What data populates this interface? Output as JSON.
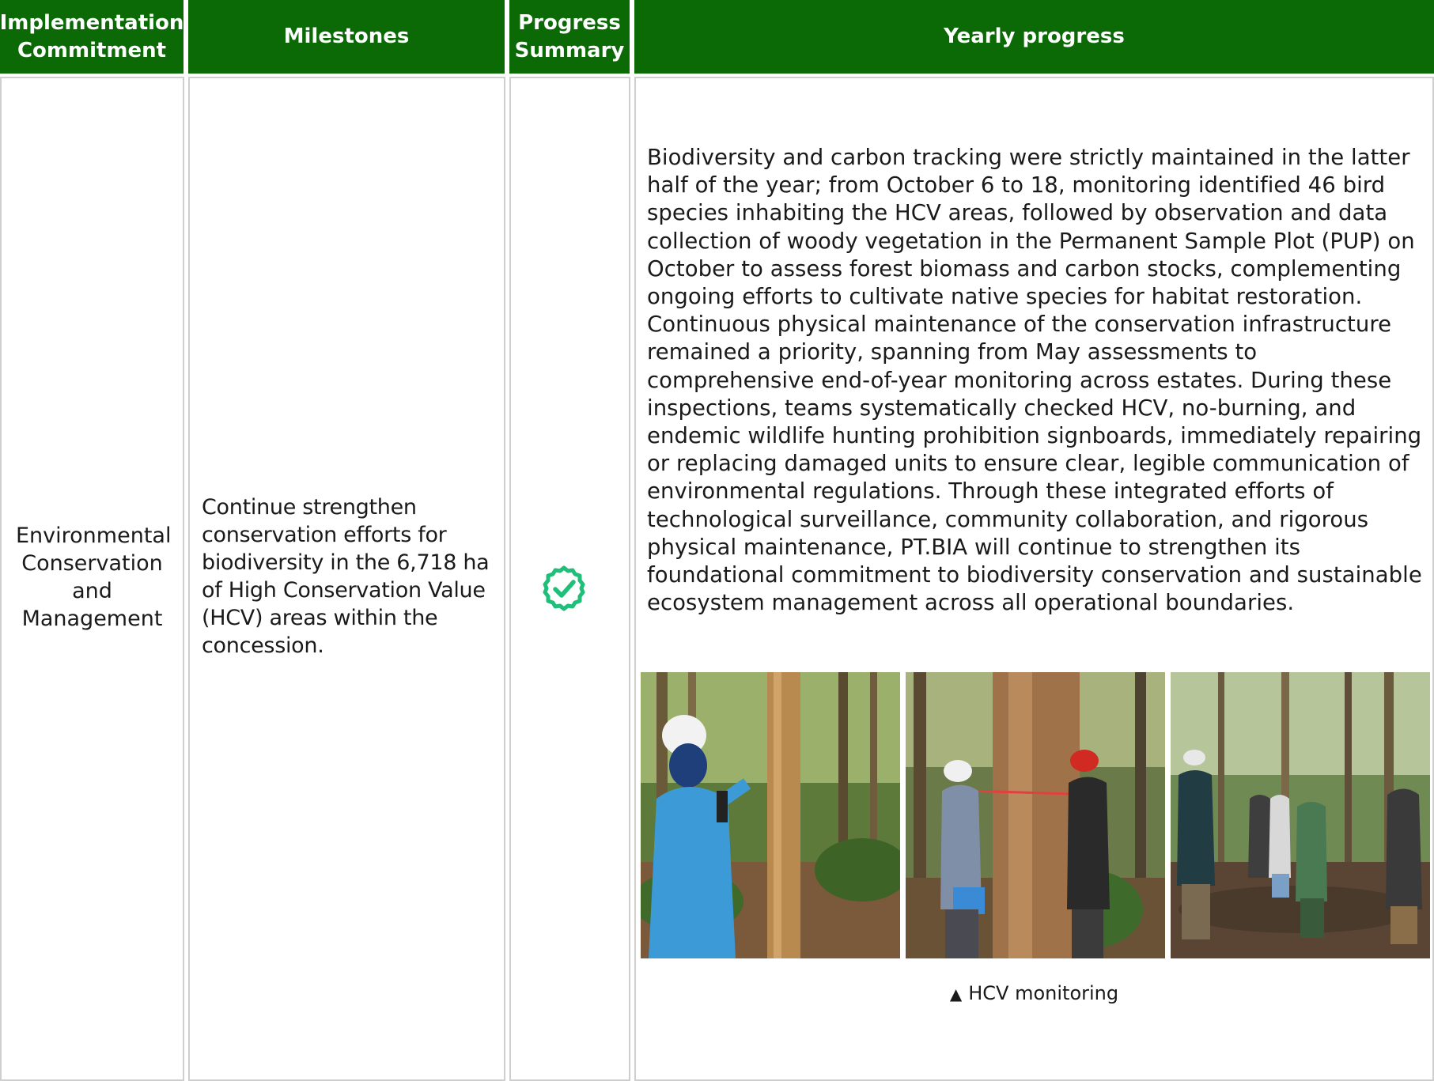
{
  "table": {
    "headers": {
      "commitment": "Implementation Commitment",
      "milestones": "Milestones",
      "progress_summary": "Progress Summary",
      "yearly_progress": "Yearly progress"
    },
    "row": {
      "commitment": "Environmental Conservation and Management",
      "milestone": "Continue strengthen conservation efforts for biodiversity in the 6,718 ha of High Conservation Value (HCV) areas within the concession.",
      "status_icon": "check-circle-icon",
      "yearly_progress": "Biodiversity and carbon tracking were strictly maintained in the latter half of the year; from October 6 to 18, monitoring identified 46 bird species inhabiting the HCV areas, followed by observation and data collection of woody vegetation in the Permanent Sample Plot (PUP) on October to assess forest biomass and carbon stocks, complementing ongoing efforts to cultivate native species for habitat restoration. Continuous physical maintenance of the conservation infrastructure remained a priority, spanning from May assessments to comprehensive end-of-year monitoring across estates. During these inspections, teams systematically checked HCV, no-burning, and endemic wildlife hunting prohibition signboards, immediately repairing or replacing damaged units to ensure clear, legible communication of environmental regulations. Through these integrated efforts of technological surveillance, community collaboration, and rigorous physical maintenance, PT.BIA will continue to strengthen its foundational commitment to biodiversity conservation and sustainable ecosystem management across all operational boundaries.",
      "photo_caption": "HCV monitoring"
    }
  },
  "colors": {
    "header_bg": "#0b6a06",
    "check_green": "#1fbf7a",
    "border": "#cfcfcf"
  }
}
